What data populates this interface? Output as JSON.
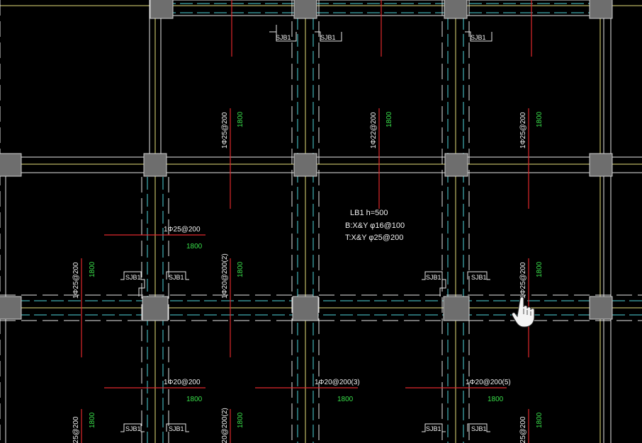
{
  "colors": {
    "background": "#000000",
    "wall": "#e8e8e8",
    "axis_yellow": "#e6e07a",
    "beam_cyan": "#4fd6dc",
    "rebar_red": "#e0282c",
    "text_white": "#f2f2f2",
    "text_green": "#39e04a",
    "column_fill": "#6e6e6e",
    "column_stroke": "#cfcfcf"
  },
  "cursor_icon": "hand-pointer-icon",
  "slab_label": {
    "name": "LB1 h=500",
    "bottom": "B:X&Y φ16@100",
    "top": "T:X&Y φ25@200"
  },
  "sump_label": "SJB1",
  "rebar_labels": {
    "top_left": "1Φ25@200",
    "top_mid": "1Φ22@200",
    "top_right": "1Φ25@200",
    "mid_h_left": "1Φ25@200",
    "mid_v_left": "1Φ25@200",
    "mid_v_center": "1Φ20@200(2)",
    "mid_v_right": "1Φ25@200",
    "mid_v_far_right": "1Φ25@200",
    "low_h_left": "1Φ20@200",
    "low_h_mid": "1Φ20@200(3)",
    "low_h_right": "1Φ20@200(5)",
    "bot_v_left": "1Φ25@200",
    "bot_v_center": "1Φ20@200(2)",
    "bot_v_right": "1Φ25@200"
  },
  "length_label": "1800"
}
